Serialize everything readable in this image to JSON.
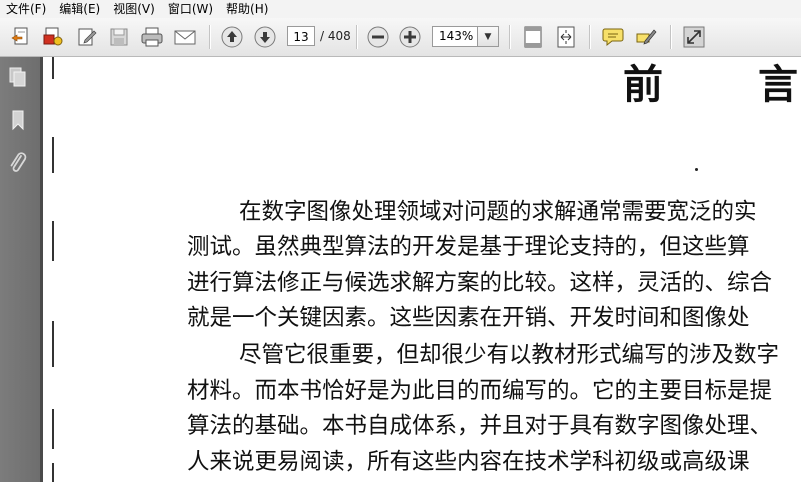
{
  "menu": [
    "文件(F)",
    "编辑(E)",
    "视图(V)",
    "窗口(W)",
    "帮助(H)"
  ],
  "toolbar": {
    "current_page": "13",
    "total_pages": "/ 408",
    "zoom": "143%"
  },
  "document": {
    "title_chars": [
      "前",
      "言"
    ],
    "paragraphs": [
      "在数字图像处理领域对问题的求解通常需要宽泛的实",
      "测试。虽然典型算法的开发是基于理论支持的，但这些算",
      "进行算法修正与候选求解方案的比较。这样，灵活的、综合",
      "就是一个关键因素。这些因素在开销、开发时间和图像处",
      "尽管它很重要，但却很少有以教材形式编写的涉及数字",
      "材料。而本书恰好是为此目的而编写的。它的主要目标是提",
      "算法的基础。本书自成体系，并且对于具有数字图像处理、",
      "人来说更易阅读，所有这些内容在技术学科初级或高级课"
    ]
  },
  "colors": {
    "panel": "#767676",
    "toolbar": "#ececec",
    "page": "#ffffff"
  }
}
